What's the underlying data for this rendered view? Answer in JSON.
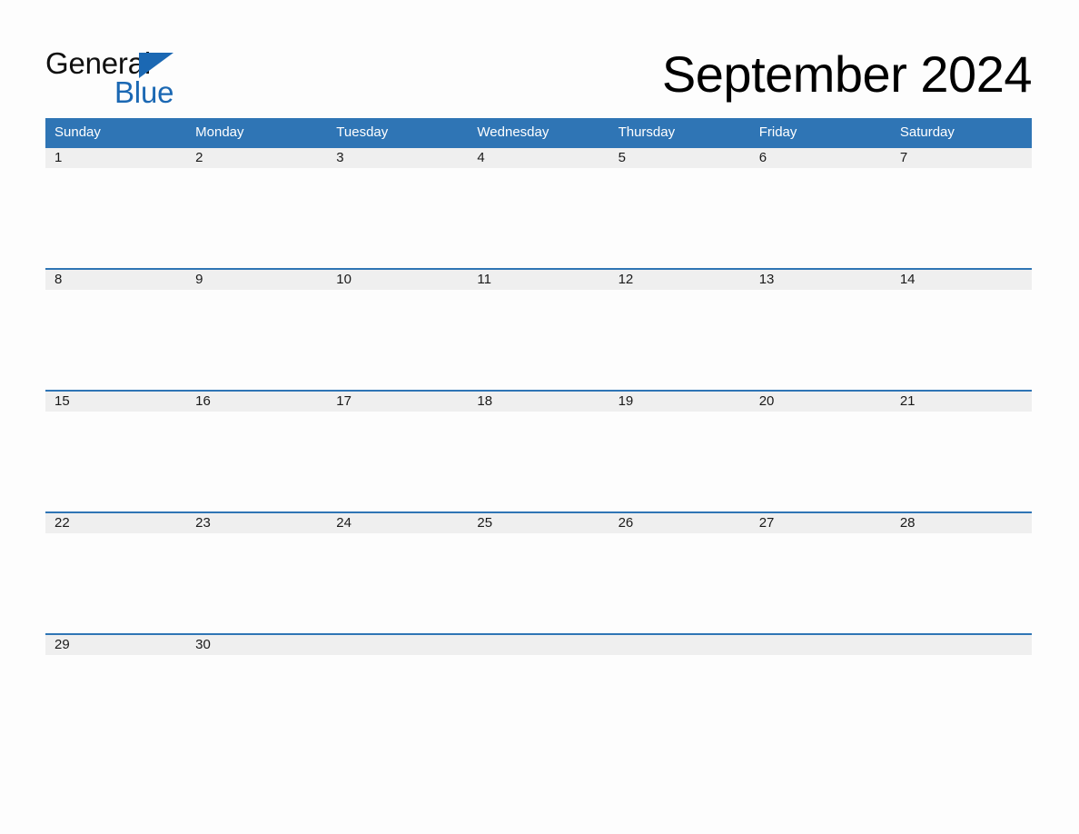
{
  "brand": {
    "line1": "General",
    "line2": "Blue",
    "triangle_icon": "triangle-icon",
    "accent_color": "#1b68b3"
  },
  "title": "September 2024",
  "calendar": {
    "header_color": "#2f75b5",
    "date_band_color": "#efefef",
    "weekdays": [
      "Sunday",
      "Monday",
      "Tuesday",
      "Wednesday",
      "Thursday",
      "Friday",
      "Saturday"
    ],
    "weeks": [
      [
        "1",
        "2",
        "3",
        "4",
        "5",
        "6",
        "7"
      ],
      [
        "8",
        "9",
        "10",
        "11",
        "12",
        "13",
        "14"
      ],
      [
        "15",
        "16",
        "17",
        "18",
        "19",
        "20",
        "21"
      ],
      [
        "22",
        "23",
        "24",
        "25",
        "26",
        "27",
        "28"
      ],
      [
        "29",
        "30",
        "",
        "",
        "",
        "",
        ""
      ]
    ]
  }
}
